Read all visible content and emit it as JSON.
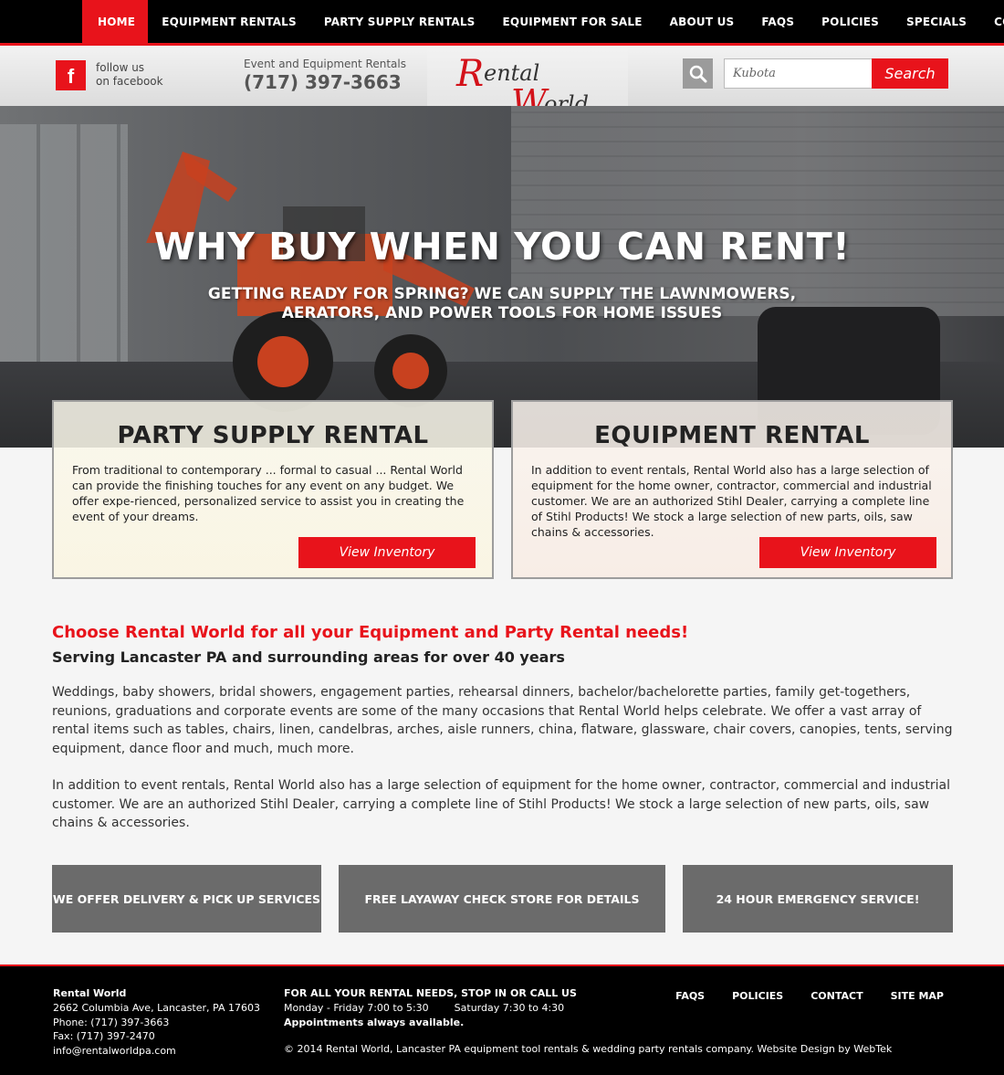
{
  "nav": {
    "items": [
      {
        "label": "HOME",
        "active": true
      },
      {
        "label": "EQUIPMENT RENTALS",
        "active": false
      },
      {
        "label": "PARTY SUPPLY RENTALS",
        "active": false
      },
      {
        "label": "EQUIPMENT FOR SALE",
        "active": false
      },
      {
        "label": "ABOUT US",
        "active": false
      },
      {
        "label": "FAQS",
        "active": false
      },
      {
        "label": "POLICIES",
        "active": false
      },
      {
        "label": "SPECIALS",
        "active": false
      },
      {
        "label": "CONTACT",
        "active": false
      }
    ]
  },
  "header": {
    "facebook_icon": "f",
    "facebook_line1": "follow us",
    "facebook_line2": "on facebook",
    "phone_label": "Event and Equipment Rentals",
    "phone": "(717) 397-3663",
    "logo": {
      "r": "R",
      "ental": "ental",
      "w": "W",
      "orld": "orld"
    }
  },
  "search": {
    "value": "Kubota",
    "button": "Search",
    "icon": "search-icon"
  },
  "hero": {
    "headline": "WHY BUY WHEN YOU CAN RENT!",
    "subline": "GETTING READY FOR SPRING? WE CAN SUPPLY THE LAWNMOWERS, AERATORS, AND POWER TOOLS FOR HOME ISSUES"
  },
  "cards": {
    "party": {
      "title": "PARTY SUPPLY RENTAL",
      "text": "From traditional to contemporary ... formal to casual ... Rental World can provide the finishing touches for any event on any budget. We offer expe-rienced, personalized service to assist you in creating the event of your dreams.",
      "button": "View Inventory"
    },
    "equipment": {
      "title": "EQUIPMENT RENTAL",
      "text": "In addition to event rentals, Rental World also has a large selection of equipment for the home owner, contractor, commercial and industrial customer.  We are an authorized Stihl Dealer, carrying a complete line of Stihl Products!  We stock a large selection of new parts, oils, saw chains & accessories.",
      "button": "View Inventory"
    }
  },
  "main": {
    "title": "Choose Rental World for all your Equipment and Party Rental needs!",
    "subtitle": "Serving Lancaster PA and surrounding areas for over 40 years",
    "para1": "Weddings, baby showers, bridal showers, engagement parties, rehearsal dinners, bachelor/bachelorette parties, family get-togethers, reunions, graduations and corporate events  are some of the many occasions that Rental World helps celebrate.   We offer a vast array of rental items such as tables, chairs, linen, candelbras, arches, aisle runners, china, flatware, glassware,  chair covers, canopies, tents, serving equipment, dance floor and much, much more.",
    "para2": "In addition to event rentals, Rental World also has a large selection of equipment for the home owner, contractor, commercial and industrial customer.  We are an authorized Stihl Dealer, carrying a complete line of Stihl Products!  We stock a large selection of new parts, oils, saw chains & accessories."
  },
  "features": [
    "WE OFFER DELIVERY & PICK UP SERVICES",
    "FREE LAYAWAY CHECK STORE FOR DETAILS",
    "24 HOUR EMERGENCY SERVICE!"
  ],
  "footer": {
    "name": "Rental World",
    "address": "2662 Columbia Ave, Lancaster, PA 17603",
    "phone": "Phone: (717) 397-3663",
    "fax": "Fax: (717) 397-2470",
    "email": "info@rentalworldpa.com",
    "hours_title": "FOR ALL YOUR RENTAL NEEDS, STOP IN OR CALL US",
    "weekday": "Monday - Friday 7:00 to 5:30",
    "saturday": "Saturday 7:30 to 4:30",
    "appointments": "Appointments always available.",
    "copyright": "© 2014 Rental World, Lancaster PA equipment tool rentals & wedding party rentals company.   Website Design by WebTek",
    "links": [
      "FAQS",
      "POLICIES",
      "CONTACT",
      "SITE MAP"
    ]
  },
  "colors": {
    "accent": "#e8131b",
    "nav_bg": "#000000",
    "feature_bg": "#6b6b6b"
  }
}
